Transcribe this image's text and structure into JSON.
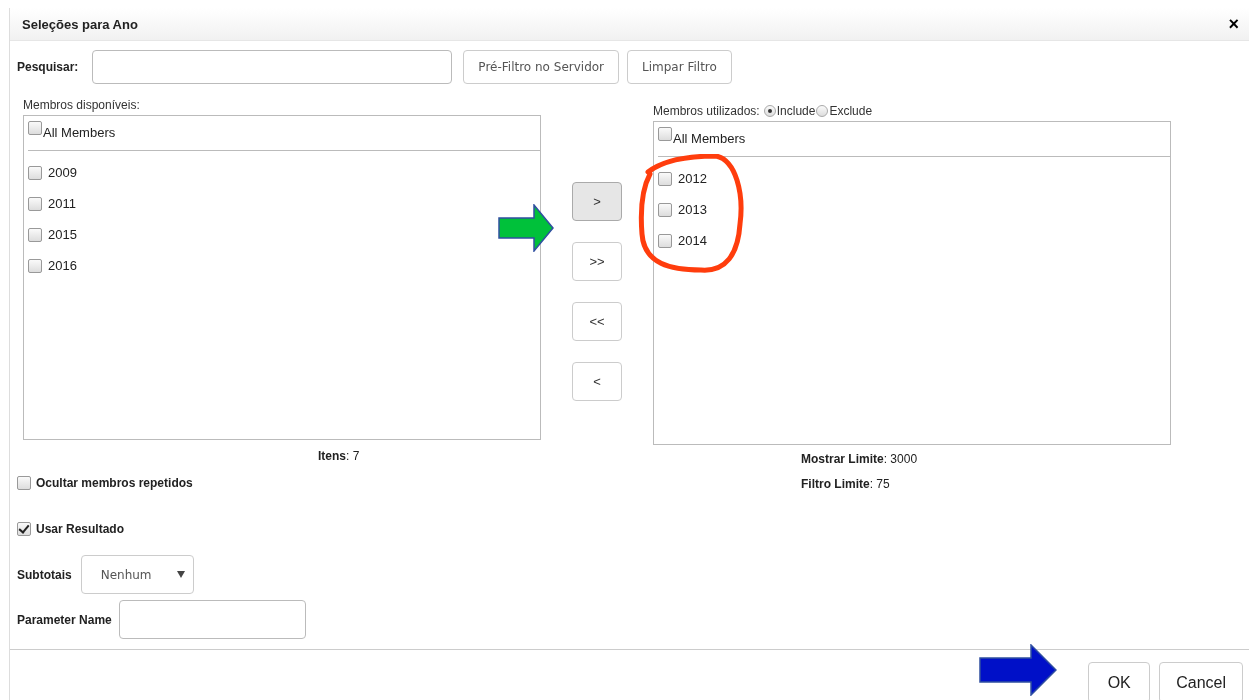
{
  "dialog": {
    "title": "Seleções para Ano",
    "close": "×"
  },
  "search": {
    "label": "Pesquisar:"
  },
  "filter_buttons": [
    "Pré-Filtro no Servidor",
    "Limpar Filtro"
  ],
  "available": {
    "label": "Membros disponíveis:",
    "all_members": {
      "label": "All Members",
      "checked": false
    },
    "items": [
      {
        "label": "2009",
        "checked": false
      },
      {
        "label": "2011",
        "checked": false
      },
      {
        "label": "2015",
        "checked": false
      },
      {
        "label": "2016",
        "checked": false
      }
    ],
    "count": "**Itens**: 7"
  },
  "move_buttons": [
    {
      "label": ">",
      "pressed": true
    },
    {
      "label": ">>",
      "pressed": false
    },
    {
      "label": "<<",
      "pressed": false
    },
    {
      "label": "<",
      "pressed": false
    }
  ],
  "used": {
    "label": "Membros utilizados:",
    "modes": [
      {
        "label": "Include",
        "selected": true
      },
      {
        "label": "Exclude",
        "selected": false
      }
    ],
    "all_members": {
      "label": "All Members",
      "checked": false
    },
    "items": [
      {
        "label": "2012",
        "checked": false
      },
      {
        "label": "2013",
        "checked": false
      },
      {
        "label": "2014",
        "checked": false
      }
    ],
    "show_limit": "**Mostrar Limite**: 3000",
    "filter_limit": "**Filtro Limite**: 75"
  },
  "options": [
    {
      "label": "Ocultar membros repetidos",
      "checked": false
    },
    {
      "label": "Usar Resultado",
      "checked": true
    }
  ],
  "subtotals": {
    "label": "Subtotais",
    "value": "Nenhum"
  },
  "parameter_name": {
    "label": "Parameter Name"
  },
  "footer_buttons": [
    "OK",
    "Cancel"
  ]
}
